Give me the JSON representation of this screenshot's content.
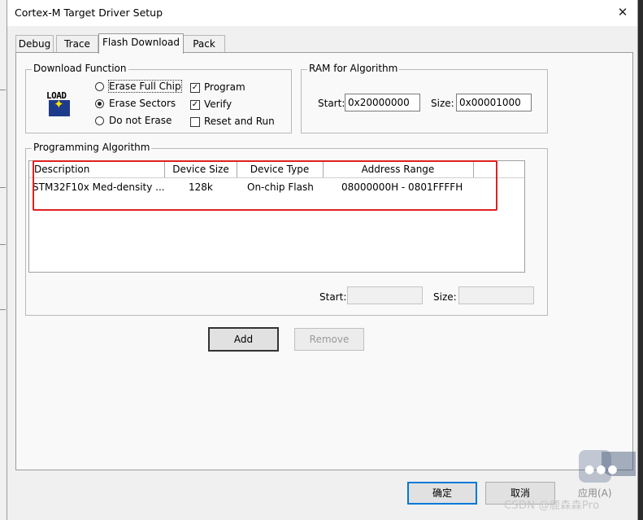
{
  "window": {
    "title": "Cortex-M Target Driver Setup",
    "close_glyph": "✕"
  },
  "tabs": [
    {
      "label": "Debug",
      "active": false
    },
    {
      "label": "Trace",
      "active": false
    },
    {
      "label": "Flash Download",
      "active": true
    },
    {
      "label": "Pack",
      "active": false
    }
  ],
  "download_function": {
    "label": "Download Function",
    "icon_text": "LOAD",
    "erase_options": [
      {
        "label": "Erase Full Chip",
        "selected": false
      },
      {
        "label": "Erase Sectors",
        "selected": true
      },
      {
        "label": "Do not Erase",
        "selected": false
      }
    ],
    "checks": [
      {
        "label": "Program",
        "checked": true
      },
      {
        "label": "Verify",
        "checked": true
      },
      {
        "label": "Reset and Run",
        "checked": false
      }
    ]
  },
  "ram": {
    "label": "RAM for Algorithm",
    "start_label": "Start:",
    "start_value": "0x20000000",
    "size_label": "Size:",
    "size_value": "0x00001000"
  },
  "programming_algorithm": {
    "label": "Programming Algorithm",
    "columns": [
      "Description",
      "Device Size",
      "Device Type",
      "Address Range"
    ],
    "rows": [
      {
        "description": "STM32F10x Med-density ...",
        "device_size": "128k",
        "device_type": "On-chip Flash",
        "address_range": "08000000H - 0801FFFFH"
      }
    ],
    "start_label": "Start:",
    "start_value": "",
    "size_label": "Size:",
    "size_value": ""
  },
  "buttons": {
    "add": "Add",
    "remove": "Remove",
    "ok": "确定",
    "cancel": "取消",
    "apply": "应用(A)"
  },
  "watermark": "CSDN @鹿森森Pro",
  "colors": {
    "highlight": "#e02020",
    "focus": "#0078d7"
  }
}
